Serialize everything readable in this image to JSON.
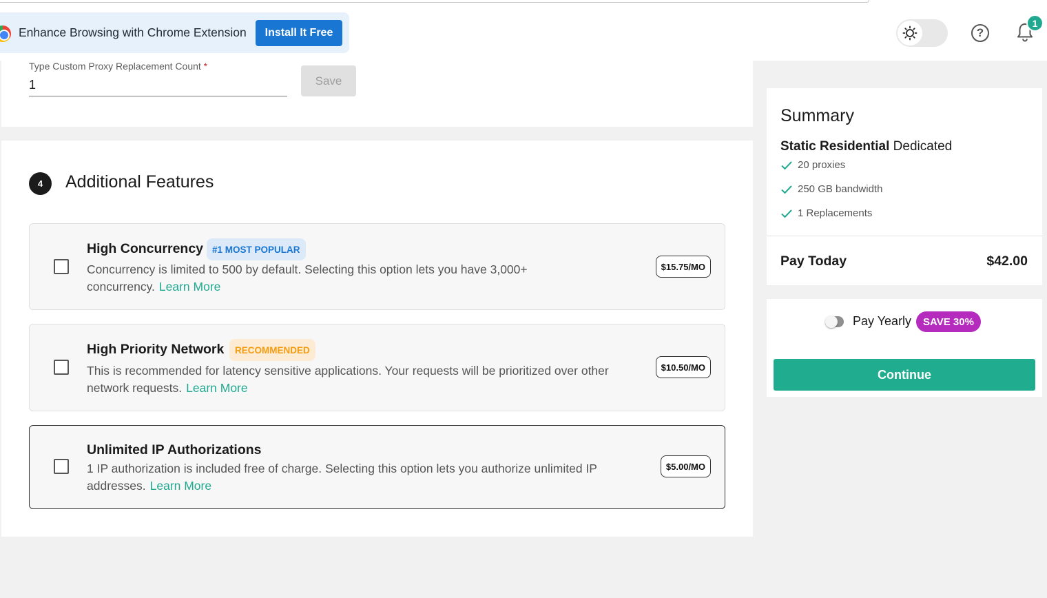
{
  "extension_banner": {
    "text": "Enhance Browsing with Chrome Extension",
    "install_label": "Install It Free"
  },
  "header": {
    "notification_count": "1",
    "help_glyph": "?"
  },
  "replacement": {
    "label": "Type Custom Proxy Replacement Count",
    "required_mark": "*",
    "value": "1",
    "save_label": "Save"
  },
  "features_section": {
    "step_number": "4",
    "title": "Additional Features",
    "learn_more_label": "Learn More",
    "items": [
      {
        "title": "High Concurrency",
        "badge": "#1 MOST POPULAR",
        "description": "Concurrency is limited to 500 by default. Selecting this option lets you have 3,000+ concurrency.",
        "price": "$15.75/MO"
      },
      {
        "title": "High Priority Network",
        "badge": "RECOMMENDED",
        "description": "This is recommended for latency sensitive applications. Your requests will be prioritized over other network requests.",
        "price": "$10.50/MO"
      },
      {
        "title": "Unlimited IP Authorizations",
        "badge": "",
        "description": "1 IP authorization is included free of charge. Selecting this option lets you authorize unlimited IP addresses.",
        "price": "$5.00/MO"
      }
    ]
  },
  "summary": {
    "title": "Summary",
    "product_name": "Static Residential",
    "product_type": "Dedicated",
    "items": [
      "20 proxies",
      "250 GB bandwidth",
      "1 Replacements"
    ],
    "pay_today_label": "Pay Today",
    "pay_today_amount": "$42.00"
  },
  "checkout": {
    "pay_yearly_label": "Pay Yearly",
    "save_badge": "SAVE 30%",
    "continue_label": "Continue"
  },
  "colors": {
    "accent_green": "#20ad8f",
    "install_blue": "#1976d2",
    "save_badge_purple": "#b42bbd"
  }
}
